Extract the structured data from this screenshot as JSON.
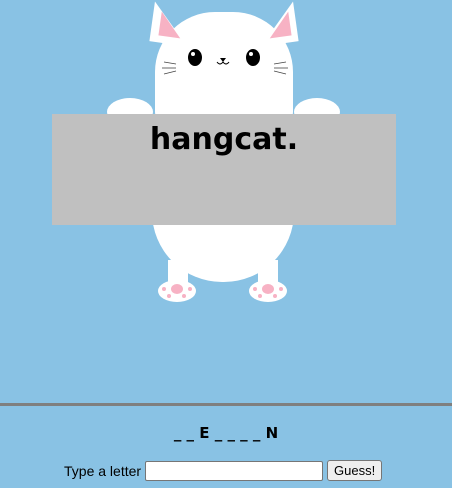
{
  "sign": {
    "title": "hangcat."
  },
  "word_display": "_ _ E _ _ _ _ N",
  "guess": {
    "label": "Type a letter",
    "input_value": "",
    "button_label": "Guess!"
  },
  "colors": {
    "background": "#89c2e4",
    "sign": "#c0c0c0",
    "cat": "#ffffff",
    "paw_pads": "#f7b2c4",
    "divider": "#7f7f7f"
  }
}
